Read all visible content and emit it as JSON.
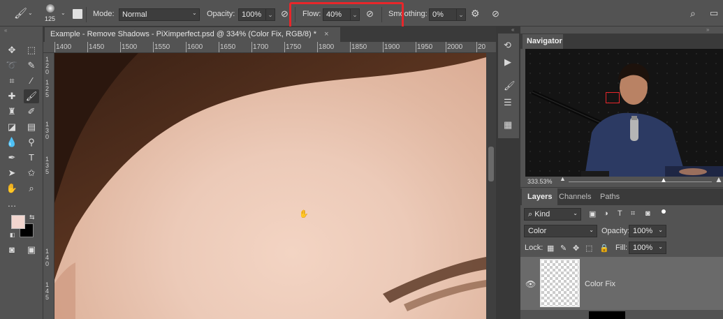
{
  "options_bar": {
    "brush_size": "125",
    "mode_label": "Mode:",
    "mode_value": "Normal",
    "opacity_label": "Opacity:",
    "opacity_value": "100%",
    "flow_label": "Flow:",
    "flow_value": "40%",
    "smoothing_label": "Smoothing:",
    "smoothing_value": "0%"
  },
  "document": {
    "tab_title": "Example - Remove Shadows - PiXimperfect.psd @ 334% (Color Fix, RGB/8) *",
    "close_glyph": "×"
  },
  "ruler": {
    "horizontal": [
      "1400",
      "1450",
      "1500",
      "1550",
      "1600",
      "1650",
      "1700",
      "1750",
      "1800",
      "1850",
      "1900",
      "1950",
      "2000",
      "20"
    ],
    "vertical": [
      "1",
      "2",
      "0",
      "1",
      "2",
      "5",
      "1",
      "3",
      "0",
      "1",
      "3",
      "5",
      "1",
      "4",
      "0",
      "1",
      "4",
      "5"
    ]
  },
  "navigator": {
    "title": "Navigator",
    "zoom": "333.53%"
  },
  "layers": {
    "tabs": [
      "Layers",
      "Channels",
      "Paths"
    ],
    "kind_label": "Kind",
    "blend_mode": "Color",
    "opacity_label": "Opacity:",
    "opacity_value": "100%",
    "lock_label": "Lock:",
    "fill_label": "Fill:",
    "fill_value": "100%",
    "layer_name": "Color Fix"
  },
  "colors": {
    "highlight": "#e8262a",
    "foreground": "#f2d6cf",
    "background": "#000000"
  },
  "icons": {
    "brush": "brush-icon",
    "search": "search-icon",
    "gear": "gear-icon",
    "eye": "eye-icon"
  }
}
